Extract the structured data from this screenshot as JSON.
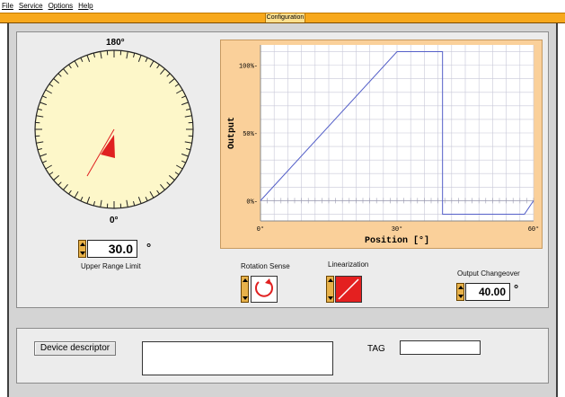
{
  "menu": [
    "File",
    "Service",
    "Options",
    "Help"
  ],
  "window_title": "Configuration",
  "dial": {
    "top_label": "180°",
    "bottom_label": "0°",
    "pointer_angle_deg": 30
  },
  "upper_range_limit": {
    "value": "30.0",
    "unit": "°",
    "label": "Upper Range Limit"
  },
  "rotation_sense": {
    "label": "Rotation Sense"
  },
  "linearization": {
    "label": "Linearization"
  },
  "output_changeover": {
    "label": "Output Changeover",
    "value": "40.00",
    "unit": "°"
  },
  "chart_data": {
    "type": "line",
    "xlabel": "Position [°]",
    "ylabel": "Output",
    "x_ticks": [
      "0°",
      "30°",
      "60°"
    ],
    "y_ticks": [
      "0%",
      "50%",
      "100%"
    ],
    "xlim": [
      0,
      60
    ],
    "ylim": [
      -15,
      115
    ],
    "grid": true,
    "series": [
      {
        "x": [
          0,
          30,
          40,
          40,
          58,
          60
        ],
        "y": [
          0,
          110,
          110,
          -10,
          -10,
          0
        ]
      }
    ]
  },
  "device_descriptor": {
    "button_label": "Device descriptor",
    "value": ""
  },
  "tag": {
    "label": "TAG",
    "value": ""
  },
  "colors": {
    "accent": "#f7a81c",
    "chart_bg": "#fad09a",
    "dial_face": "#fdf7c9",
    "line": "#5560c8",
    "pointer": "#e02020"
  }
}
